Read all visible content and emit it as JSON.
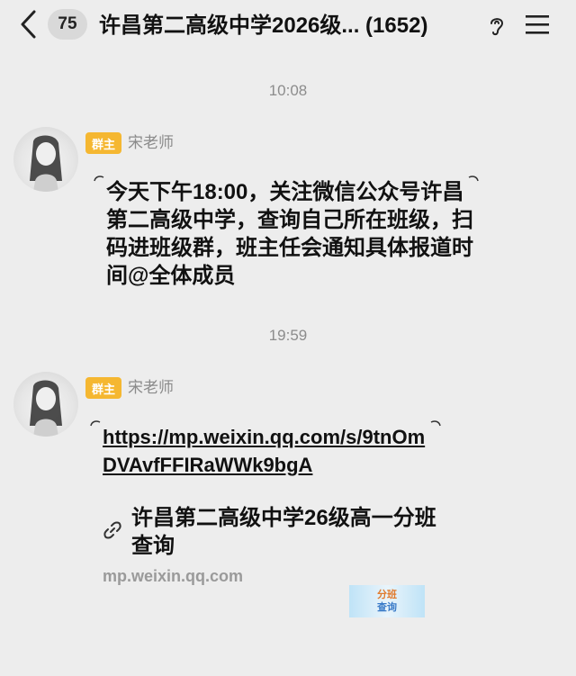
{
  "header": {
    "unread_count": "75",
    "title": "许昌第二高级中学2026级... (1652)"
  },
  "messages": [
    {
      "time": "10:08",
      "owner_tag": "群主",
      "sender": "宋老师",
      "text": "今天下午18:00，关注微信公众号许昌第二高级中学，查询自己所在班级，扫码进班级群，班主任会通知具体报道时间@全体成员"
    },
    {
      "time": "19:59",
      "owner_tag": "群主",
      "sender": "宋老师",
      "link_url": "https://mp.weixin.qq.com/s/9tnOmDVAvfFFIRaWWk9bgA",
      "card_title": "许昌第二高级中学26级高一分班查询",
      "card_domain": "mp.weixin.qq.com",
      "thumb_line1": "分班",
      "thumb_line2": "查询"
    }
  ],
  "icons": {
    "back": "chevron-left-icon",
    "ear": "ear-icon",
    "menu": "hamburger-menu-icon",
    "link": "chain-link-icon"
  },
  "colors": {
    "background": "#ededed",
    "owner_tag": "#f5b731",
    "time_text": "#8c8c8c"
  }
}
